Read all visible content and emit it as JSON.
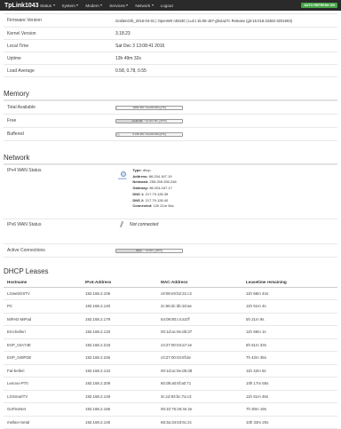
{
  "header": {
    "brand": "TpLink1043",
    "menu": [
      {
        "label": "Status"
      },
      {
        "label": "System"
      },
      {
        "label": "Modem"
      },
      {
        "label": "Services"
      },
      {
        "label": "Network"
      },
      {
        "label": "Logout"
      }
    ],
    "autorefresh": "AUTO REFRESH ON"
  },
  "system": {
    "rows": [
      {
        "label": "Firmware Version",
        "value": "GoldenOrb_2016-04-01 | OpenWrt r48430 | LuCI 15.05-187-gfe2a27c Release (git-16.018.33482-3201903)"
      },
      {
        "label": "Kernel Version",
        "value": "3.18.23"
      },
      {
        "label": "Local Time",
        "value": "Sat Dec 3 13:08:41 2016"
      },
      {
        "label": "Uptime",
        "value": "13h 49m 32s"
      },
      {
        "label": "Load Average",
        "value": "0.58, 0.78, 0.55"
      }
    ]
  },
  "memory": {
    "title": "Memory",
    "rows": [
      {
        "label": "Total Available",
        "text": "1660 kB / 61160 kB (2%)",
        "fraction": 0.02
      },
      {
        "label": "Free",
        "text": "2436 kB / 61160 kB (39%)",
        "fraction": 0.39
      },
      {
        "label": "Buffered",
        "text": "4196 kB / 61160 kB (6%)",
        "fraction": 0.06
      }
    ]
  },
  "network": {
    "title": "Network",
    "ipv4_label": "IPv4 WAN Status",
    "wan_icon_label": "wwan0",
    "ipv4": {
      "type_k": "Type:",
      "type_v": "dhcp",
      "address_k": "Address:",
      "address_v": "86.204.167.19",
      "netmask_k": "Netmask:",
      "netmask_v": "255.255.255.248",
      "gateway_k": "Gateway:",
      "gateway_v": "86.204.167.17",
      "dns1_k": "DNS 1:",
      "dns1_v": "217.79.128.35",
      "dns2_k": "DNS 2:",
      "dns2_v": "217.79.128.40",
      "connected_k": "Connected:",
      "connected_v": "12h 21m 54s"
    },
    "ipv6_label": "IPv6 WAN Status",
    "ipv6_value": "Not connected",
    "active_label": "Active Connections",
    "active_text": "5632 / 16384 (38%)",
    "active_fraction": 0.38
  },
  "dhcp": {
    "title": "DHCP Leases",
    "columns": [
      "Hostname",
      "IPv4-Address",
      "MAC-Address",
      "Leasetime remaining"
    ],
    "rows": [
      [
        "LGwebOSTV",
        "192.168.2.106",
        "c8:08:e9:b2:31:c2",
        "11h 58m 44s"
      ],
      [
        "PC",
        "192.168.2.140",
        "2c:56:dc:3b:18:ae",
        "11h 51m 4s"
      ],
      [
        "MiPAD-MiPad",
        "192.168.2.179",
        "64:09:80:c4:a3:ff",
        "5h 21m 9s"
      ],
      [
        "Emi-belleri",
        "192.168.2.133",
        "00:1d:ac:0e:d5:37",
        "11h 59m 1s"
      ],
      [
        "ESP_04A74E",
        "192.168.2.218",
        "c0:27:00:04:a7:4e",
        "6h 51m 33s"
      ],
      [
        "ESP_049FDE",
        "192.168.2.246",
        "c0:27:00:04:9f:de",
        "7h 42m 35s"
      ],
      [
        "Fat-belleri",
        "192.168.2.134",
        "00:1d:ac:0e:d5:38",
        "11h 42m 5s"
      ],
      [
        "Lenovo-P70",
        "192.168.2.209",
        "60:d9:a0:6f:a0:71",
        "10h 17m 55s"
      ],
      [
        "LGSmartTV",
        "192.168.2.149",
        "3c:cd:93:bc:7a:c3",
        "11h 51m 46s"
      ],
      [
        "GoFlexNet",
        "192.168.2.166",
        "00:10:75:26:4e:2e",
        "7h 30m 19s"
      ],
      [
        "mellan-metal",
        "192.168.2.145",
        "68:3a:34:63:6c:2c",
        "10h 33m 20s"
      ]
    ]
  }
}
